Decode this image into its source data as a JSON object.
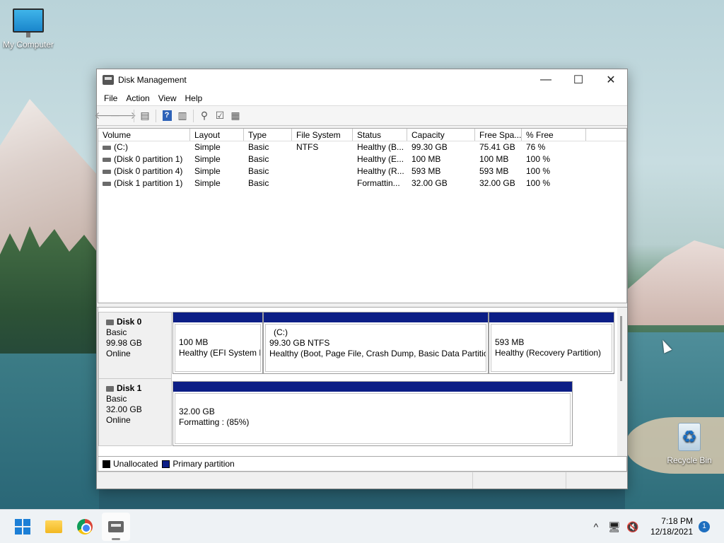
{
  "desktop": {
    "icons": [
      {
        "label": "My Computer",
        "icon": "monitor-icon"
      },
      {
        "label": "Recycle Bin",
        "icon": "recycle-bin-icon"
      }
    ]
  },
  "window": {
    "title": "Disk Management",
    "controls": {
      "minimize": "—",
      "maximize": "☐",
      "close": "✕"
    },
    "menu": [
      "File",
      "Action",
      "View",
      "Help"
    ],
    "toolbar": {
      "back": "🡐",
      "forward": "🡒",
      "help": "?"
    },
    "volume_list": {
      "columns": [
        "Volume",
        "Layout",
        "Type",
        "File System",
        "Status",
        "Capacity",
        "Free Spa...",
        "% Free"
      ],
      "rows": [
        {
          "volume": "(C:)",
          "layout": "Simple",
          "type": "Basic",
          "fs": "NTFS",
          "status": "Healthy (B...",
          "capacity": "99.30 GB",
          "free": "75.41 GB",
          "pct": "76 %"
        },
        {
          "volume": "(Disk 0 partition 1)",
          "layout": "Simple",
          "type": "Basic",
          "fs": "",
          "status": "Healthy (E...",
          "capacity": "100 MB",
          "free": "100 MB",
          "pct": "100 %"
        },
        {
          "volume": "(Disk 0 partition 4)",
          "layout": "Simple",
          "type": "Basic",
          "fs": "",
          "status": "Healthy (R...",
          "capacity": "593 MB",
          "free": "593 MB",
          "pct": "100 %"
        },
        {
          "volume": "(Disk 1 partition 1)",
          "layout": "Simple",
          "type": "Basic",
          "fs": "",
          "status": "Formattin...",
          "capacity": "32.00 GB",
          "free": "32.00 GB",
          "pct": "100 %"
        }
      ]
    },
    "disks": [
      {
        "name": "Disk 0",
        "type": "Basic",
        "size": "99.98 GB",
        "state": "Online",
        "partitions": [
          {
            "name": "",
            "size": "100 MB",
            "status": "Healthy (EFI System P"
          },
          {
            "name": "(C:)",
            "size": "99.30 GB NTFS",
            "status": "Healthy (Boot, Page File, Crash Dump, Basic Data Partition"
          },
          {
            "name": "",
            "size": "593 MB",
            "status": "Healthy (Recovery Partition)"
          }
        ]
      },
      {
        "name": "Disk 1",
        "type": "Basic",
        "size": "32.00 GB",
        "state": "Online",
        "partitions": [
          {
            "name": "",
            "size": "32.00 GB",
            "status": "Formatting : (85%)"
          }
        ]
      }
    ],
    "legend": [
      {
        "label": "Unallocated",
        "color": "#000000"
      },
      {
        "label": "Primary partition",
        "color": "#0c1e86"
      }
    ]
  },
  "taskbar": {
    "time": "7:18 PM",
    "date": "12/18/2021",
    "notifications": "1",
    "tray": {
      "chevron": "^",
      "network": "🖥",
      "volume": "🔇"
    }
  }
}
